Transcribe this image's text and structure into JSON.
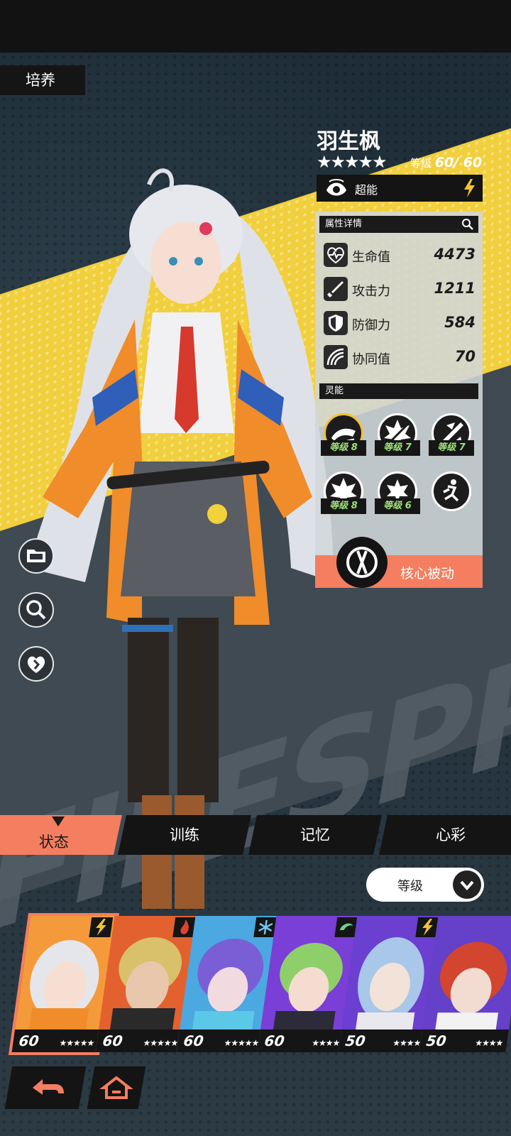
{
  "page": {
    "tab": "培养"
  },
  "character": {
    "name": "羽生枫",
    "stars": "★★★★★",
    "level_label": "等级",
    "level": "60/ 60",
    "type": "超能",
    "type_icon": "psychic-eye-icon",
    "element_icon": "lightning-icon"
  },
  "attributes": {
    "title": "属性详情",
    "stats": [
      {
        "icon": "heart-pulse-icon",
        "label": "生命值",
        "value": "4473"
      },
      {
        "icon": "sword-icon",
        "label": "攻击力",
        "value": "1211"
      },
      {
        "icon": "shield-icon",
        "label": "防御力",
        "value": "584"
      },
      {
        "icon": "sync-waves-icon",
        "label": "协同值",
        "value": "70"
      }
    ]
  },
  "psi": {
    "title": "灵能",
    "skills": [
      {
        "tag": "等级 8"
      },
      {
        "tag": "等级 7"
      },
      {
        "tag": "等级 7"
      },
      {
        "tag": "等级 8"
      },
      {
        "tag": "等级 6"
      }
    ],
    "core_passive": "核心被动"
  },
  "tabs": [
    "状态",
    "训练",
    "记忆",
    "心彩"
  ],
  "sort": {
    "label": "等级"
  },
  "roster": [
    {
      "level": "60",
      "stars": "★★★★★",
      "element": "lightning",
      "color": "#f59a3a"
    },
    {
      "level": "60",
      "stars": "★★★★★",
      "element": "fire",
      "color": "#e3612f"
    },
    {
      "level": "60",
      "stars": "★★★★★",
      "element": "ice",
      "color": "#4ba8e0"
    },
    {
      "level": "60",
      "stars": "★★★★",
      "element": "wind",
      "color": "#7a3fd6"
    },
    {
      "level": "50",
      "stars": "★★★★",
      "element": "lightning",
      "color": "#6b3fd0"
    },
    {
      "level": "50",
      "stars": "★★★★",
      "element": "fire",
      "color": "#6540c9"
    }
  ],
  "colors": {
    "accent": "#f47e5f",
    "skill_level": "#9ee07a",
    "highlight": "#f2c233"
  }
}
